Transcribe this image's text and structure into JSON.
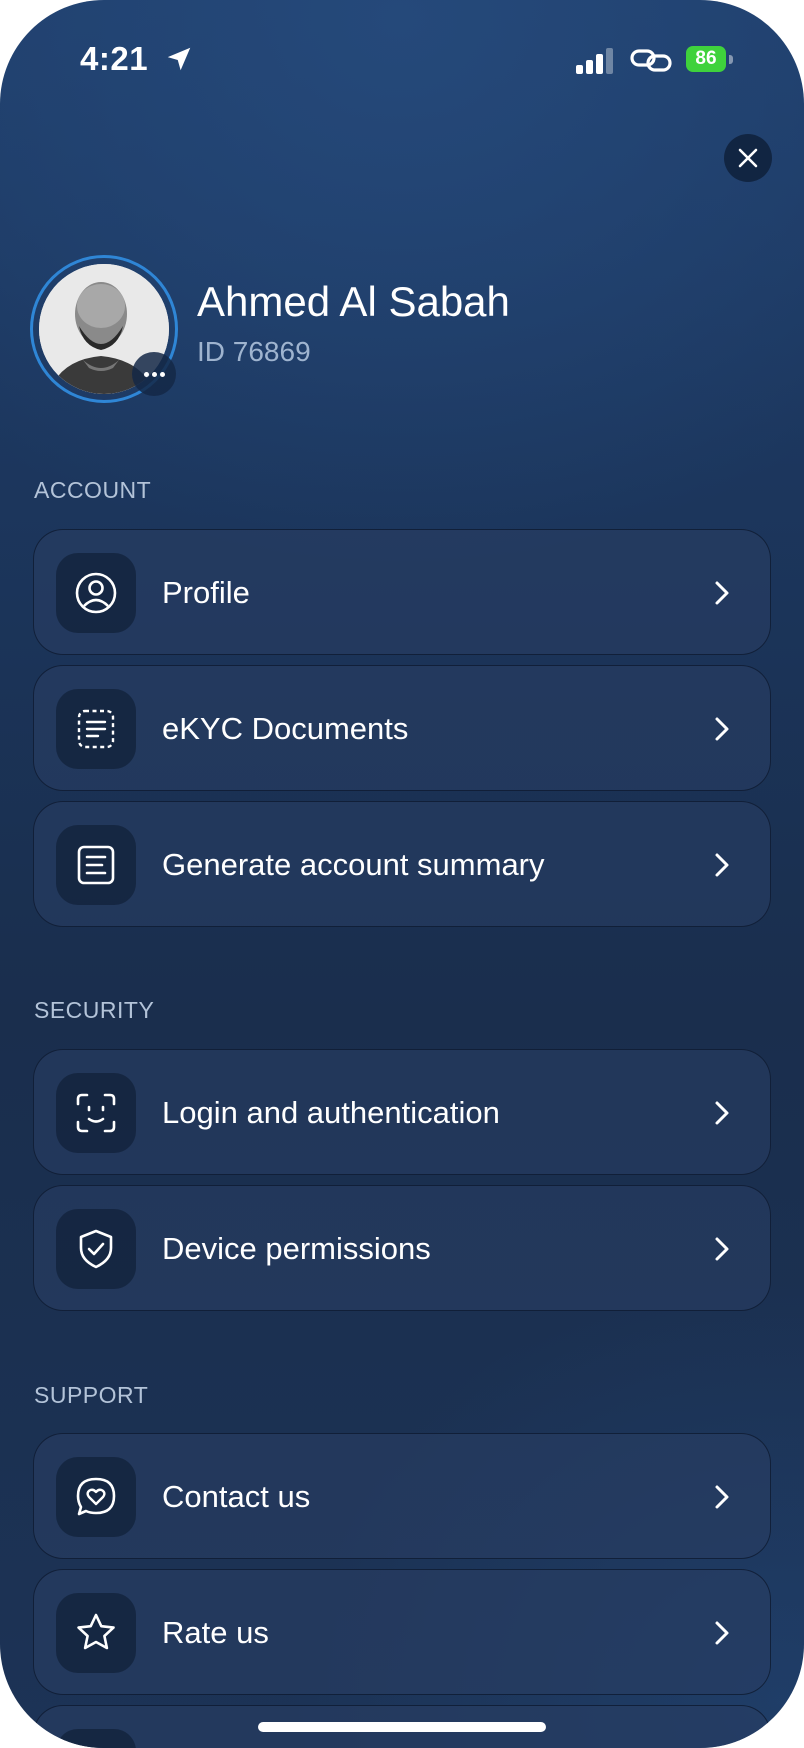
{
  "status_bar": {
    "time": "4:21",
    "battery": "86",
    "battery_color": "#3fd23c",
    "icons": [
      "location-arrow-icon",
      "signal-icon",
      "link-icon",
      "battery-icon"
    ]
  },
  "close_icon": "close-icon",
  "profile": {
    "name": "Ahmed Al Sabah",
    "id_label": "ID 76869",
    "accent_color": "#2f86d6"
  },
  "sections": [
    {
      "title": "ACCOUNT",
      "items": [
        {
          "label": "Profile",
          "icon": "user-circle-icon"
        },
        {
          "label": "eKYC Documents",
          "icon": "document-scan-icon"
        },
        {
          "label": "Generate account summary",
          "icon": "summary-document-icon"
        }
      ]
    },
    {
      "title": "SECURITY",
      "items": [
        {
          "label": "Login and authentication",
          "icon": "face-id-icon"
        },
        {
          "label": "Device permissions",
          "icon": "shield-check-icon"
        }
      ]
    },
    {
      "title": "SUPPORT",
      "items": [
        {
          "label": "Contact us",
          "icon": "chat-heart-icon"
        },
        {
          "label": "Rate us",
          "icon": "star-icon"
        }
      ]
    }
  ]
}
